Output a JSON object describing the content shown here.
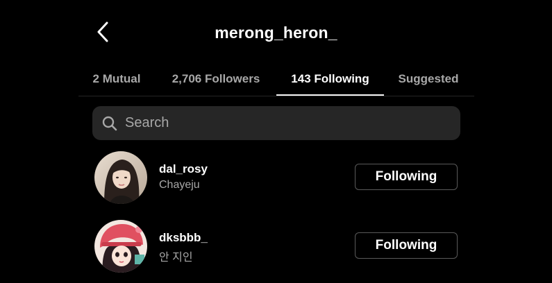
{
  "header": {
    "title": "merong_heron_",
    "back_icon": "chevron-left-icon"
  },
  "tabs": [
    {
      "label": "2 Mutual",
      "active": false
    },
    {
      "label": "2,706 Followers",
      "active": false
    },
    {
      "label": "143 Following",
      "active": true
    },
    {
      "label": "Suggested",
      "active": false
    }
  ],
  "search": {
    "placeholder": "Search",
    "value": "",
    "icon": "search-icon"
  },
  "users": [
    {
      "username": "dal_rosy",
      "full_name": "Chayeju",
      "button_label": "Following"
    },
    {
      "username": "dksbbb_",
      "full_name": "안 지인",
      "button_label": "Following"
    }
  ],
  "colors": {
    "background": "#000000",
    "search_bg": "#262626",
    "secondary_text": "#a8a8a8",
    "button_border": "#5a5a5a"
  }
}
